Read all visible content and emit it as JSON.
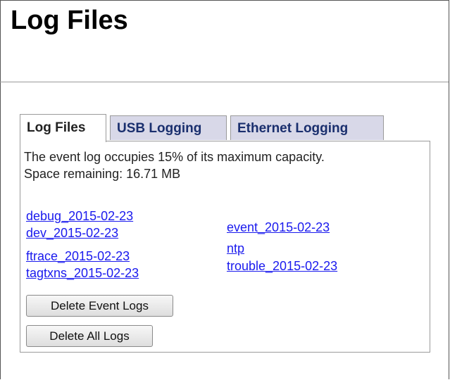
{
  "page": {
    "title": "Log Files"
  },
  "tabs": [
    {
      "label": "Log Files",
      "active": true
    },
    {
      "label": "USB Logging",
      "active": false
    },
    {
      "label": "Ethernet Logging",
      "active": false
    }
  ],
  "status": {
    "capacity_text": "The event log occupies 15% of its maximum capacity.",
    "remaining_text": "Space remaining: 16.71 MB"
  },
  "log_files": {
    "left_column": [
      "debug_2015-02-23",
      "dev_2015-02-23",
      "ftrace_2015-02-23",
      "tagtxns_2015-02-23"
    ],
    "right_column": [
      "event_2015-02-23",
      "ntp",
      "trouble_2015-02-23"
    ]
  },
  "buttons": {
    "delete_event_logs": "Delete Event Logs",
    "delete_all_logs": "Delete All Logs"
  },
  "colors": {
    "link": "#1a1aee",
    "inactive_tab_bg": "#d8d8e8",
    "inactive_tab_text": "#1a2f6e"
  }
}
